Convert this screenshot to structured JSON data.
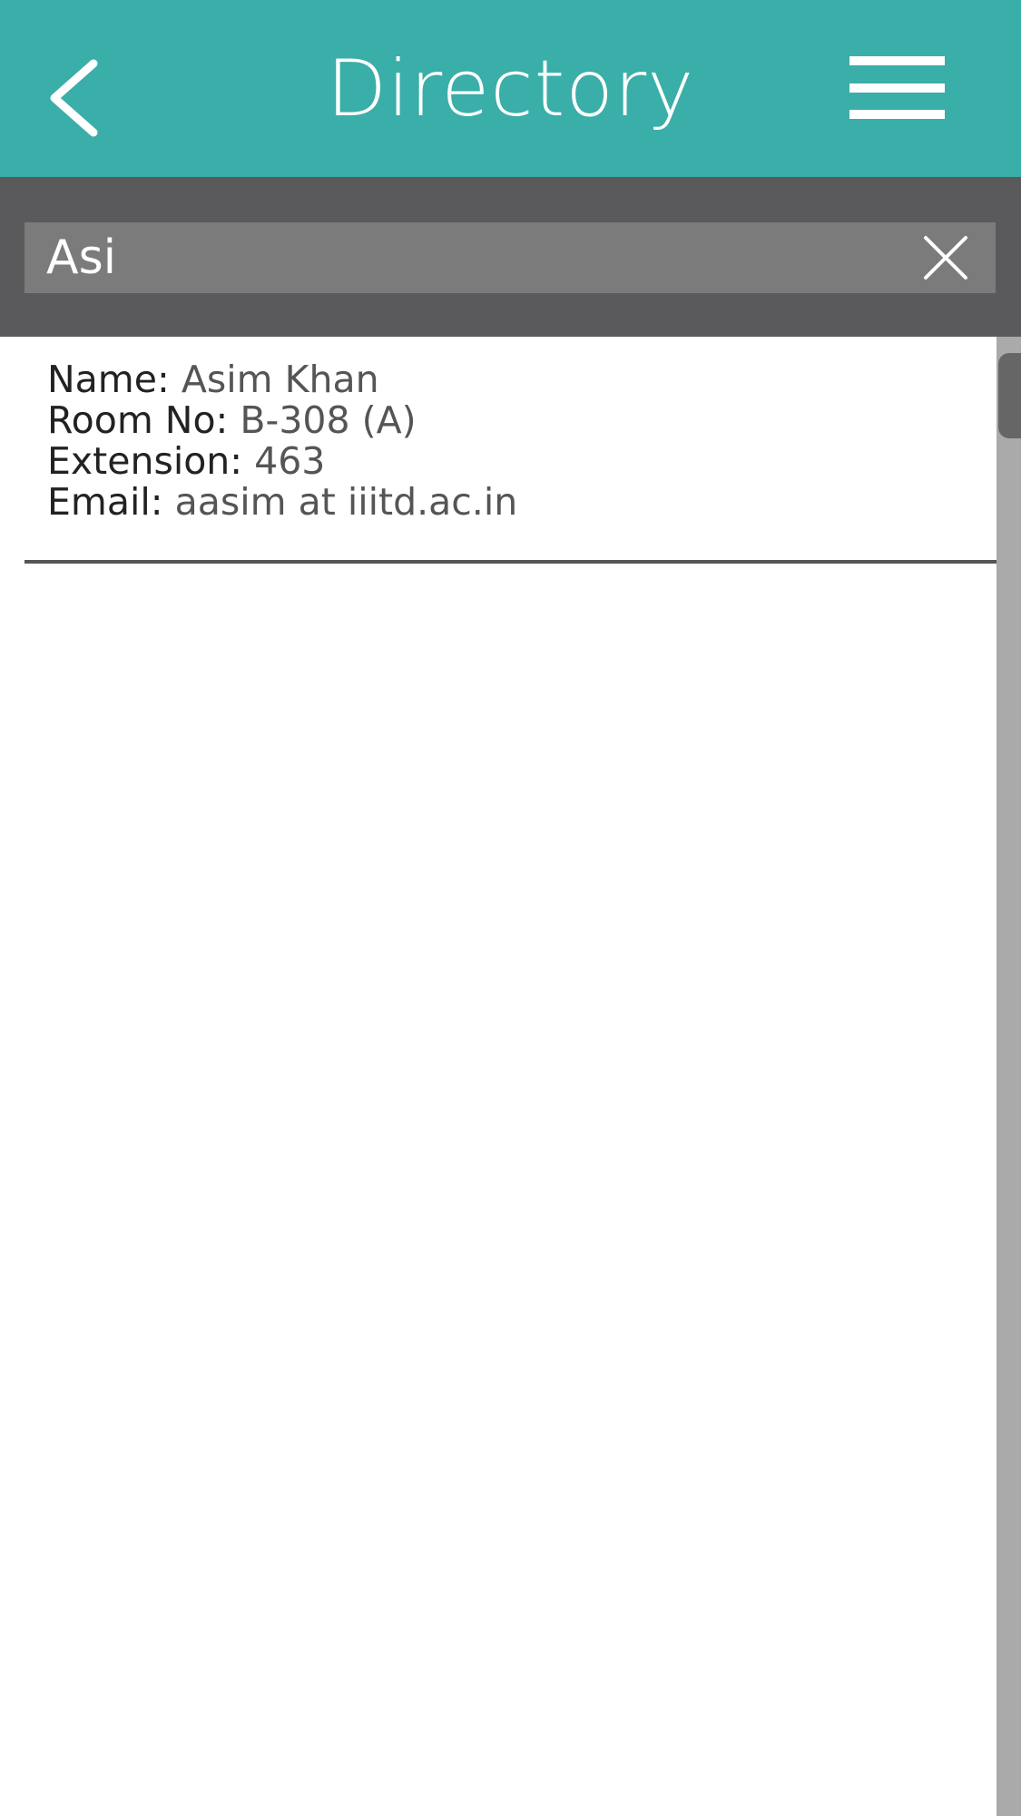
{
  "header": {
    "title": "Directory",
    "back_icon": "chevron-left-icon",
    "menu_icon": "hamburger-menu-icon"
  },
  "search": {
    "value": "Asi",
    "clear_icon": "close-icon"
  },
  "results": [
    {
      "name_label": "Name:",
      "name": "Asim Khan",
      "room_label": "Room No:",
      "room": "B-308 (A)",
      "ext_label": "Extension:",
      "extension": "463",
      "email_label": "Email:",
      "email": "aasim at iiitd.ac.in"
    }
  ],
  "colors": {
    "header": "#3aaea8",
    "search_bar": "#5a5a5c",
    "input": "#7b7b7b"
  }
}
